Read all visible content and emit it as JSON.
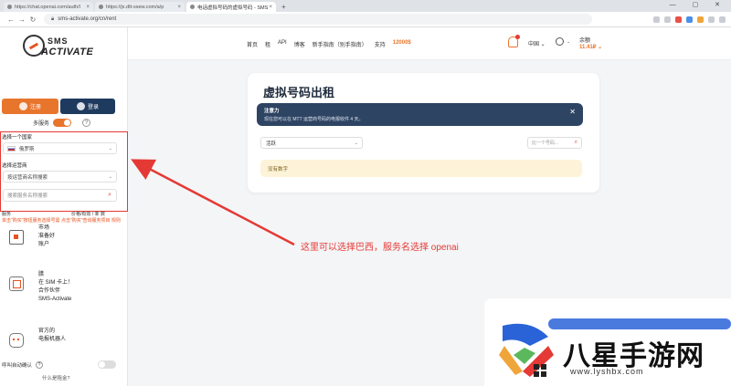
{
  "browser": {
    "tabs": [
      {
        "label": "https://chat.openai.com/auth/l",
        "active": false
      },
      {
        "label": "https://jx.dtt-ssew.com/a/p",
        "active": false
      },
      {
        "label": "电话虚拟号码的虚拟号码 - SMS",
        "active": true
      }
    ],
    "url": "sms-activate.org/cn/rent",
    "window_controls": "— ▢ ✕"
  },
  "logo": {
    "line1": "SMS",
    "line2": "ACTIVATE"
  },
  "sidebar": {
    "register_label": "注册",
    "login_label": "登录",
    "multiservice_label": "多服务",
    "country_label": "选择一个国家",
    "country_value": "俄罗斯",
    "service_label": "选择运营商",
    "service_placeholder": "按运营商名称搜索",
    "search_placeholder": "搜索服务名称搜索",
    "col_service": "服务",
    "col_price": "价格/有效 / 率 数",
    "note": "单击\"购买\"按钮服务选择号需 点击\"购买\"查询服务项目 规则",
    "promos": [
      {
        "icon": "sim-icon",
        "text": "市场\n准备好\n账户"
      },
      {
        "icon": "chip-icon",
        "text": "腊\n在 SIM 卡上！\n合作伙伴\nSMS-Activate"
      },
      {
        "icon": "bot-icon",
        "text": "官方的\n电报机器人"
      }
    ],
    "auto_label": "呼叫自动确认",
    "what_label": "什么是租金?"
  },
  "topnav": {
    "menu": [
      "首页",
      "租",
      "API",
      "博客",
      "新手指南（别手指南）",
      "支持"
    ],
    "price": "12000$",
    "lang": "中国 ⌄",
    "balance_label": "余额",
    "balance_value": "11.41₽ ⌄"
  },
  "main": {
    "title": "虚拟号码出租",
    "notice_title": "注意力",
    "notice_body": "现在您可以在 MTT 运营商号码的电报收件 4 天。",
    "filter_value": "活跃",
    "search_placeholder": "比一个号码...",
    "empty_text": "没有数字"
  },
  "annotation": "这里可以选择巴西，服务名选择 openai",
  "watermark": {
    "brand": "八星手游网",
    "url": "www.lyshbx.com"
  }
}
